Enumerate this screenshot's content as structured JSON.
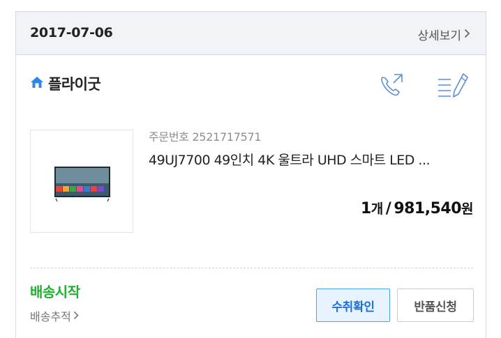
{
  "order": {
    "date": "2017-07-06",
    "detail_link": "상세보기",
    "shop_name": "플라이굿",
    "order_number_label": "주문번호",
    "order_number": "2521717571",
    "product_name": "49UJ7700 49인치 4K 울트라 UHD 스마트 LED ...",
    "quantity": "1",
    "quantity_unit": "개",
    "price": "981,540",
    "price_unit": "원",
    "status": "배송시작",
    "tracking_link": "배송추적"
  },
  "buttons": {
    "confirm": "수취확인",
    "return": "반품신청"
  },
  "colors": {
    "accent_blue": "#1e6fd8",
    "status_green": "#1db22e",
    "header_bg": "#f1f3f6",
    "icon_blue": "#5a8fd6"
  },
  "icons": [
    "home-icon",
    "phone-call-icon",
    "write-review-icon",
    "chevron-right-icon"
  ]
}
